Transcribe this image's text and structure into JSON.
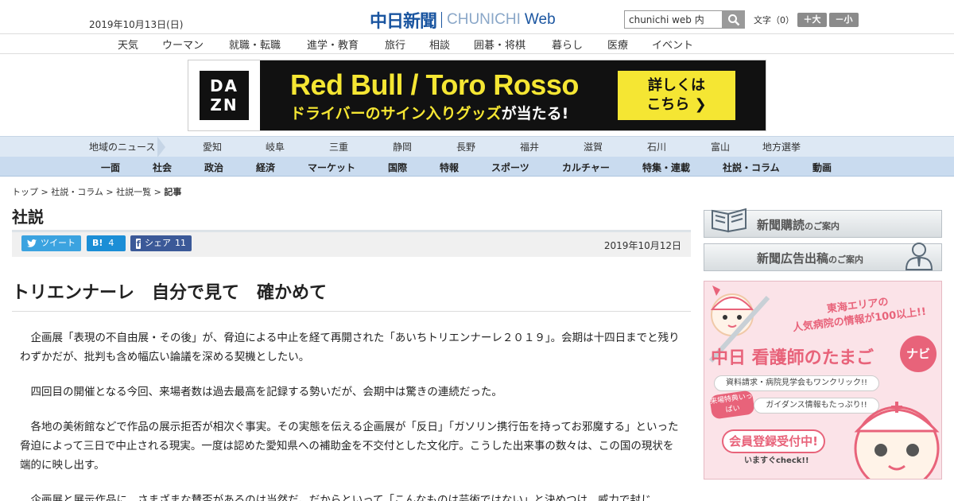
{
  "header": {
    "date": "2019年10月13日(日)",
    "logo_jp": "中日新聞",
    "logo_en": "CHUNICHI",
    "logo_web": "Web",
    "search_value": "chunichi web 内",
    "fontsize_label": "文字（0）",
    "font_increase": "＋大",
    "font_decrease": "－小"
  },
  "nav_main": [
    "天気",
    "ウーマン",
    "就職・転職",
    "進学・教育",
    "旅行",
    "相談",
    "囲碁・将棋",
    "暮らし",
    "医療",
    "イベント"
  ],
  "banner": {
    "brand_line1": "DA",
    "brand_line2": "ZN",
    "title": "Red Bull / Toro Rosso",
    "subtitle_a": "ドライバーのサイン入りグッズ",
    "subtitle_b": "が当たる!",
    "cta_line1": "詳しくは",
    "cta_line2": "こちら ❯"
  },
  "nav_regional": {
    "label": "地域のニュース",
    "items": [
      "愛知",
      "岐阜",
      "三重",
      "静岡",
      "長野",
      "福井",
      "滋賀",
      "石川",
      "富山",
      "地方選挙"
    ]
  },
  "nav_category": [
    "一面",
    "社会",
    "政治",
    "経済",
    "マーケット",
    "国際",
    "特報",
    "スポーツ",
    "カルチャー",
    "特集・連載",
    "社説・コラム",
    "動画"
  ],
  "breadcrumb": [
    "トップ",
    "社説・コラム",
    "社説一覧",
    "記事"
  ],
  "breadcrumb_sep": " > ",
  "section_title": "社説",
  "share": {
    "tweet": "ツイート",
    "hatena_label": "B!",
    "hatena_count": "4",
    "facebook": "シェア",
    "facebook_count": "11"
  },
  "pub_date": "2019年10月12日",
  "article": {
    "headline": "トリエンナーレ　自分で見て　確かめて",
    "paragraphs": [
      "企画展「表現の不自由展・その後」が、脅迫による中止を経て再開された「あいちトリエンナーレ２０１９」。会期は十四日までと残りわずかだが、批判も含め幅広い論議を深める契機としたい。",
      "四回目の開催となる今回、来場者数は過去最高を記録する勢いだが、会期中は驚きの連続だった。",
      "各地の美術館などで作品の展示拒否が相次ぐ事実。その実態を伝える企画展が「反日」「ガソリン携行缶を持ってお邪魔する」といった脅迫によって三日で中止される現実。一度は認めた愛知県への補助金を不交付とした文化庁。こうした出来事の数々は、この国の現状を端的に映し出す。",
      "企画展と展示作品に、さまざまな賛否があるのは当然だ。だからといって「こんなものは芸術ではない」と決めつけ、威力で封じ"
    ]
  },
  "sidebar": {
    "subscribe_main": "新聞購読",
    "subscribe_small": "のご案内",
    "ad_main": "新聞広告出稿",
    "ad_small": "のご案内",
    "promo": {
      "line1": "東海エリアの",
      "line2": "人気病院の情報が100以上!!",
      "title": "中日 看護師のたまご",
      "navi": "ナビ",
      "pill1": "資料請求・病院見学会もワンクリック!!",
      "badge": "来場特典いっぱい",
      "pill2": "ガイダンス情報もたっぷり!!",
      "cta": "会員登録受付中!",
      "cta2": "いますぐcheck!!"
    }
  },
  "colors": {
    "brand_blue": "#1a55a0",
    "twitter": "#3ba3e0",
    "hatena": "#1b8ed6",
    "facebook": "#3b5998",
    "banner_yellow": "#f5e633",
    "promo_pink": "#e8637a"
  }
}
